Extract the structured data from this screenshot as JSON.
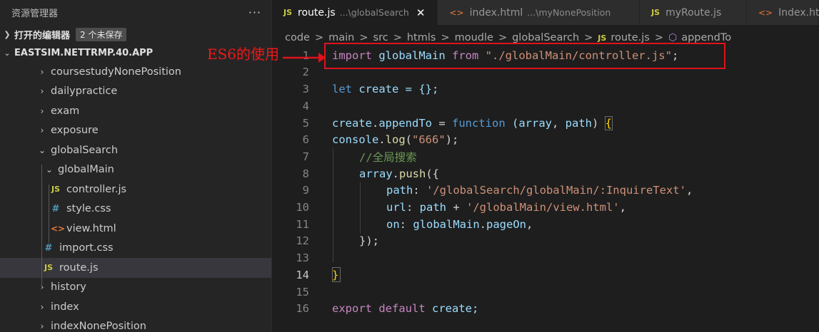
{
  "sidebar": {
    "title": "资源管理器",
    "more": "···",
    "open_editors": "打开的编辑器",
    "unsaved_badge": "2 个未保存",
    "project": "EASTSIM.NETTRMP.40.APP",
    "items": [
      {
        "label": "coursestudyNonePosition"
      },
      {
        "label": "dailypractice"
      },
      {
        "label": "exam"
      },
      {
        "label": "exposure"
      },
      {
        "label": "globalSearch"
      },
      {
        "label": "globalMain"
      },
      {
        "label": "controller.js",
        "icon": "JS"
      },
      {
        "label": "style.css",
        "icon": "#"
      },
      {
        "label": "view.html",
        "icon": "<>"
      },
      {
        "label": "import.css",
        "icon": "#"
      },
      {
        "label": "route.js",
        "icon": "JS"
      },
      {
        "label": "history"
      },
      {
        "label": "index"
      },
      {
        "label": "indexNonePosition"
      }
    ]
  },
  "tabs": [
    {
      "icon": "JS",
      "label": "route.js",
      "desc": "...\\globalSearch",
      "close": "✕"
    },
    {
      "icon": "<>",
      "label": "index.html",
      "desc": "...\\myNonePosition"
    },
    {
      "icon": "JS",
      "label": "myRoute.js"
    },
    {
      "icon": "<>",
      "label": "Index.ht"
    }
  ],
  "breadcrumb": [
    "code",
    "main",
    "src",
    "htmls",
    "moudle",
    "globalSearch",
    "route.js",
    "appendTo"
  ],
  "breadcrumb_sep": ">",
  "breadcrumb_js_icon": "JS",
  "breadcrumb_symbol_icon": "⬡",
  "editor": {
    "line_numbers": [
      "1",
      "2",
      "3",
      "4",
      "5",
      "6",
      "7",
      "8",
      "9",
      "10",
      "11",
      "12",
      "13",
      "14",
      "15",
      "16"
    ],
    "line1": {
      "kw": "import",
      "id": " globalMain ",
      "from": "from",
      "sp": " ",
      "str": "\"./globalMain/controller.js\"",
      "end": ";"
    },
    "line3": {
      "kw": "let",
      "rest": " create = {};"
    },
    "line5": {
      "obj": "create",
      "dot": ".",
      "prop": "appendTo",
      "eq": " = ",
      "kw": "function",
      "sp": " ",
      "p1": "(array",
      "comma": ", ",
      "p2": "path",
      "p3": ") ",
      "brace": "{"
    },
    "line6": {
      "obj": "console",
      "dot": ".",
      "fn": "log",
      "open": "(",
      "str": "\"666\"",
      "close": ");"
    },
    "line7": {
      "comment": "//全局搜索"
    },
    "line8": {
      "obj": "array",
      "dot": ".",
      "fn": "push",
      "rest": "({"
    },
    "line9": {
      "key": "path",
      "colon": ": ",
      "str": "'/globalSearch/globalMain/:InquireText'",
      "comma": ","
    },
    "line10": {
      "key": "url",
      "colon": ": ",
      "var": "path",
      "plus": " + ",
      "str": "'/globalMain/view.html'",
      "comma": ","
    },
    "line11": {
      "key": "on",
      "colon": ": ",
      "var": "globalMain",
      "dot": ".",
      "prop": "pageOn",
      "comma": ","
    },
    "line12": {
      "text": "});"
    },
    "line14": {
      "brace": "}"
    },
    "line16": {
      "kw": "export",
      "sp": " ",
      "kw2": "default",
      "rest": " create;"
    }
  },
  "annotation": "ES6的使用"
}
